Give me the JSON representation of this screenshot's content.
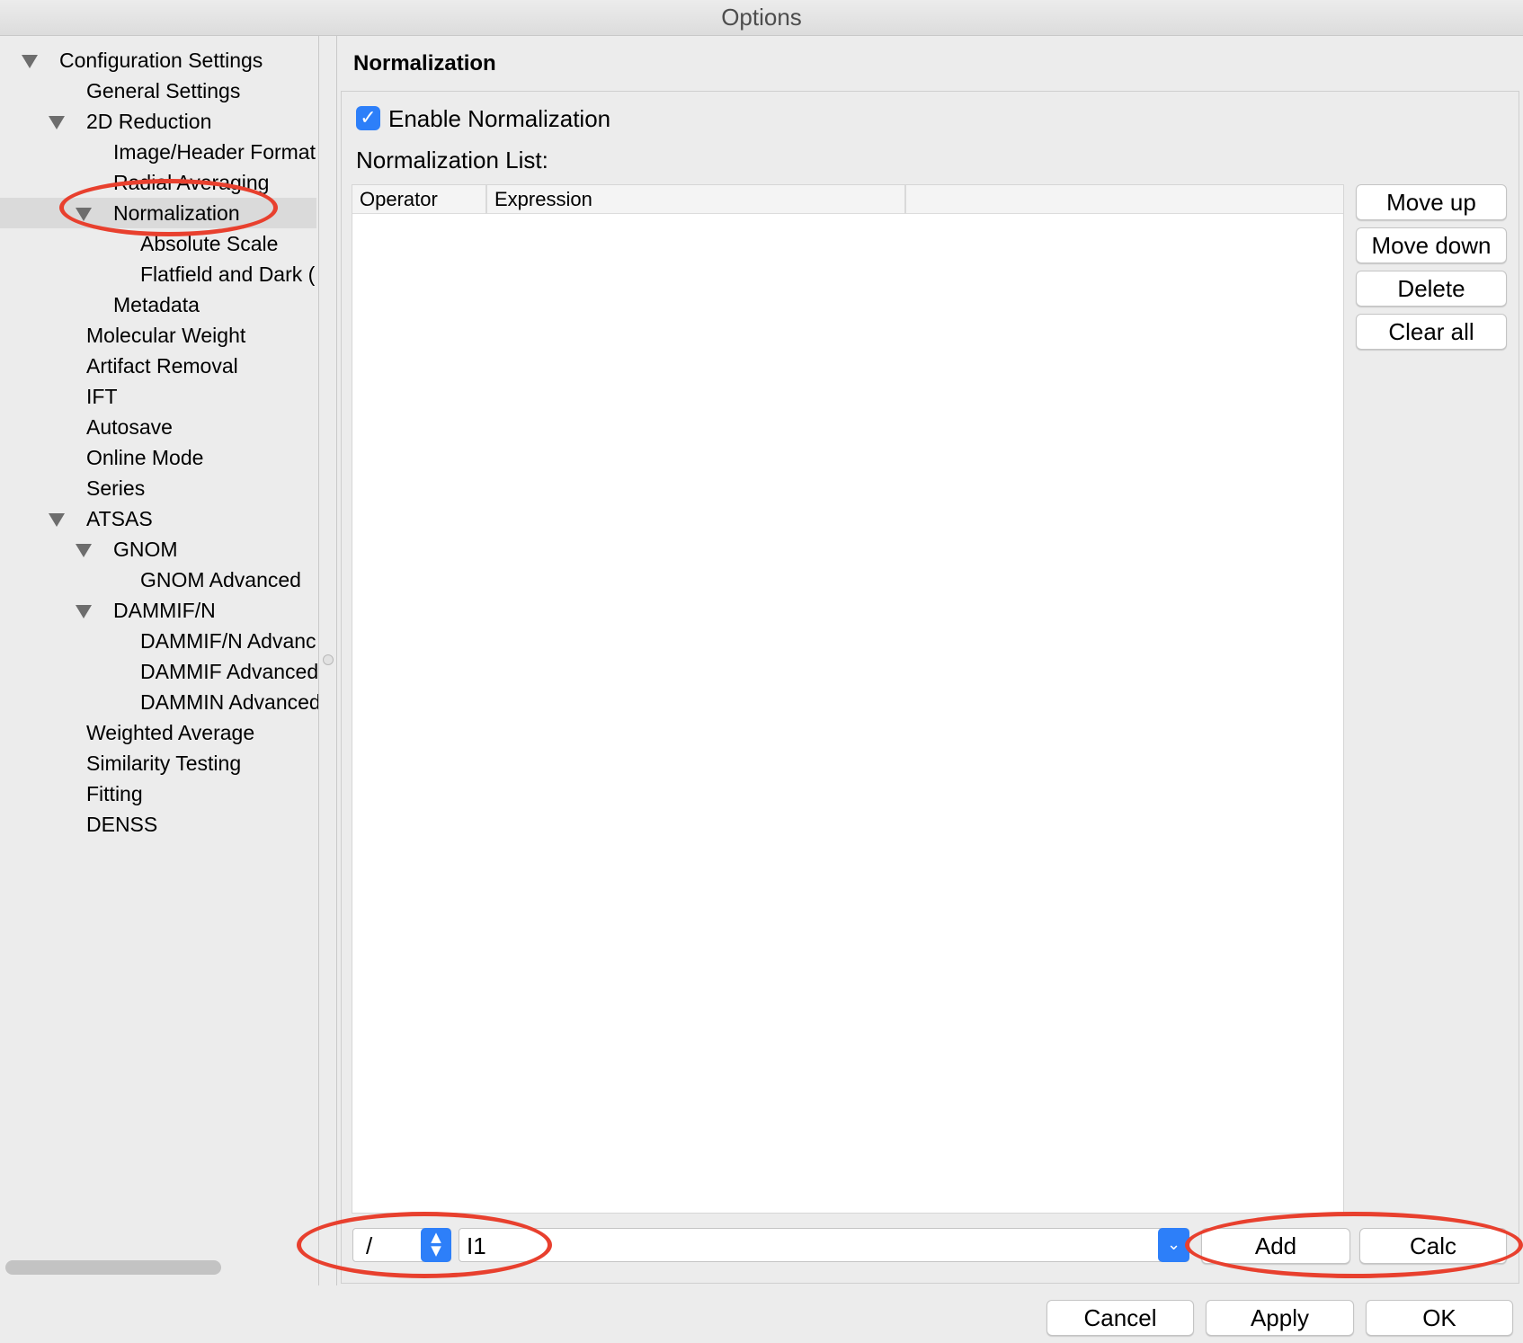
{
  "window": {
    "title": "Options"
  },
  "tree": {
    "items": [
      {
        "label": "Configuration Settings",
        "level": 0,
        "expanded": true
      },
      {
        "label": "General Settings",
        "level": 1,
        "expanded": null
      },
      {
        "label": "2D Reduction",
        "level": 1,
        "expanded": true
      },
      {
        "label": "Image/Header Format",
        "level": 2,
        "expanded": null
      },
      {
        "label": "Radial Averaging",
        "level": 2,
        "expanded": null
      },
      {
        "label": "Normalization",
        "level": 2,
        "expanded": true,
        "selected": true
      },
      {
        "label": "Absolute Scale",
        "level": 3,
        "expanded": null
      },
      {
        "label": "Flatfield and Dark (",
        "level": 3,
        "expanded": null
      },
      {
        "label": "Metadata",
        "level": 2,
        "expanded": null
      },
      {
        "label": "Molecular Weight",
        "level": 1,
        "expanded": null
      },
      {
        "label": "Artifact Removal",
        "level": 1,
        "expanded": null
      },
      {
        "label": "IFT",
        "level": 1,
        "expanded": null
      },
      {
        "label": "Autosave",
        "level": 1,
        "expanded": null
      },
      {
        "label": "Online Mode",
        "level": 1,
        "expanded": null
      },
      {
        "label": "Series",
        "level": 1,
        "expanded": null
      },
      {
        "label": "ATSAS",
        "level": 1,
        "expanded": true
      },
      {
        "label": "GNOM",
        "level": 2,
        "expanded": true
      },
      {
        "label": "GNOM Advanced",
        "level": 3,
        "expanded": null
      },
      {
        "label": "DAMMIF/N",
        "level": 2,
        "expanded": true
      },
      {
        "label": "DAMMIF/N Advanc",
        "level": 3,
        "expanded": null
      },
      {
        "label": "DAMMIF Advanced",
        "level": 3,
        "expanded": null
      },
      {
        "label": "DAMMIN Advanced",
        "level": 3,
        "expanded": null
      },
      {
        "label": "Weighted Average",
        "level": 1,
        "expanded": null
      },
      {
        "label": "Similarity Testing",
        "level": 1,
        "expanded": null
      },
      {
        "label": "Fitting",
        "level": 1,
        "expanded": null
      },
      {
        "label": "DENSS",
        "level": 1,
        "expanded": null
      }
    ]
  },
  "panel": {
    "title": "Normalization",
    "enable_label": "Enable Normalization",
    "enable_checked": true,
    "list_label": "Normalization List:",
    "columns": [
      "Operator",
      "Expression"
    ],
    "rows": [],
    "side_buttons": {
      "move_up": "Move up",
      "move_down": "Move down",
      "delete": "Delete",
      "clear_all": "Clear all"
    },
    "operator_value": "/",
    "expression_value": "I1",
    "add_label": "Add",
    "calc_label": "Calc"
  },
  "footer": {
    "cancel": "Cancel",
    "apply": "Apply",
    "ok": "OK"
  },
  "colors": {
    "accent": "#2d7ff9",
    "annotation": "#e8402e",
    "selection": "#dadada"
  }
}
